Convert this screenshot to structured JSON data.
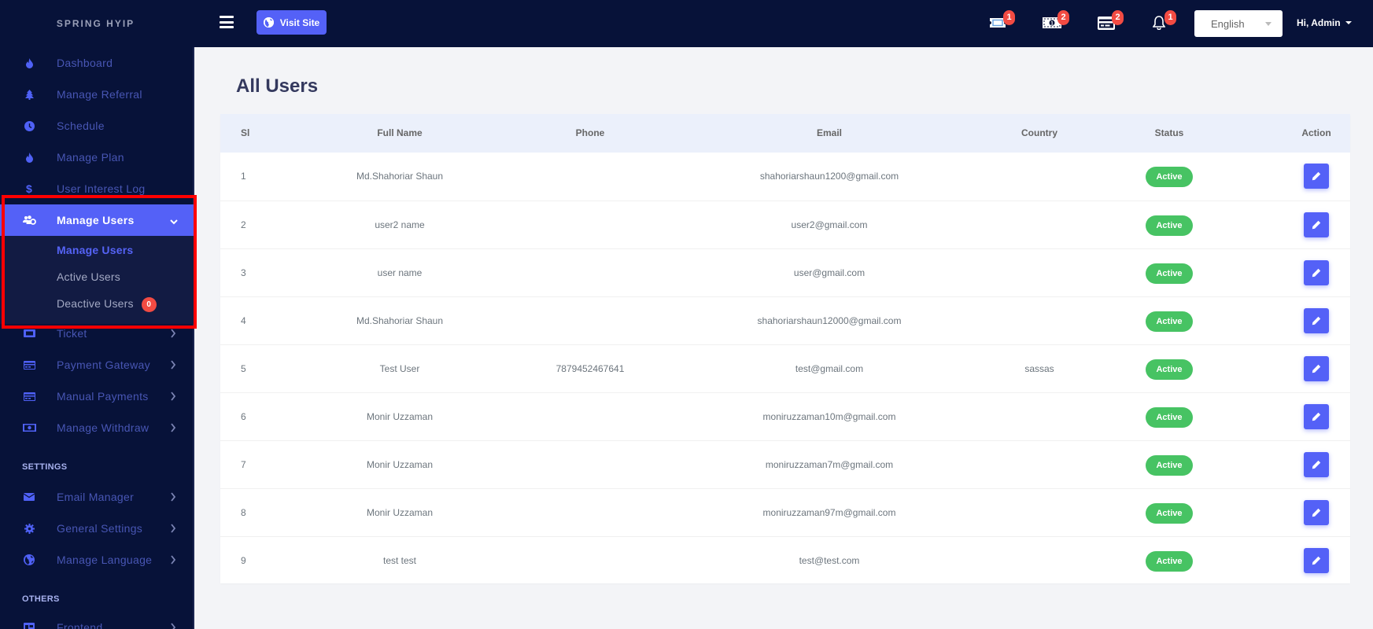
{
  "brand": "SPRING HYIP",
  "sidebar": {
    "items": [
      {
        "label": "Dashboard",
        "icon": "fire-icon"
      },
      {
        "label": "Manage Referral",
        "icon": "tree-icon"
      },
      {
        "label": "Schedule",
        "icon": "clock-icon"
      },
      {
        "label": "Manage Plan",
        "icon": "fire-icon"
      },
      {
        "label": "User Interest Log",
        "icon": "dollar-icon"
      },
      {
        "label": "Manage Users",
        "icon": "users-cog-icon",
        "active": true,
        "expanded": true
      },
      {
        "label": "Ticket",
        "icon": "ticket-icon"
      },
      {
        "label": "Payment Gateway",
        "icon": "credit-card-icon"
      },
      {
        "label": "Manual Payments",
        "icon": "credit-card-icon"
      },
      {
        "label": "Manage Withdraw",
        "icon": "money-bill-icon"
      }
    ],
    "submenu": [
      {
        "label": "Manage Users",
        "current": true
      },
      {
        "label": "Active Users"
      },
      {
        "label": "Deactive Users",
        "badge": "0"
      }
    ],
    "settings_title": "SETTINGS",
    "settings_items": [
      {
        "label": "Email Manager",
        "icon": "envelope-icon"
      },
      {
        "label": "General Settings",
        "icon": "gear-icon"
      },
      {
        "label": "Manage Language",
        "icon": "globe-icon"
      }
    ],
    "others_title": "OTHERS",
    "others_items": [
      {
        "label": "Frontend",
        "icon": "layout-icon"
      }
    ]
  },
  "topbar": {
    "visit_site_label": "Visit Site",
    "notifications": [
      {
        "icon": "ticket-icon",
        "count": "1"
      },
      {
        "icon": "money-bill-icon",
        "count": "2"
      },
      {
        "icon": "credit-card-icon",
        "count": "2"
      },
      {
        "icon": "bell-icon",
        "count": "1"
      }
    ],
    "language": "English",
    "user_greeting": "Hi, Admin"
  },
  "page": {
    "title": "All Users"
  },
  "table": {
    "columns": [
      "Sl",
      "Full Name",
      "Phone",
      "Email",
      "Country",
      "Status",
      "Action"
    ],
    "rows": [
      {
        "sl": "1",
        "name": "Md.Shahoriar Shaun",
        "phone": "",
        "email": "shahoriarshaun1200@gmail.com",
        "country": "",
        "status": "Active"
      },
      {
        "sl": "2",
        "name": "user2 name",
        "phone": "",
        "email": "user2@gmail.com",
        "country": "",
        "status": "Active"
      },
      {
        "sl": "3",
        "name": "user name",
        "phone": "",
        "email": "user@gmail.com",
        "country": "",
        "status": "Active"
      },
      {
        "sl": "4",
        "name": "Md.Shahoriar Shaun",
        "phone": "",
        "email": "shahoriarshaun12000@gmail.com",
        "country": "",
        "status": "Active"
      },
      {
        "sl": "5",
        "name": "Test User",
        "phone": "7879452467641",
        "email": "test@gmail.com",
        "country": "sassas",
        "status": "Active"
      },
      {
        "sl": "6",
        "name": "Monir Uzzaman",
        "phone": "",
        "email": "moniruzzaman10m@gmail.com",
        "country": "",
        "status": "Active"
      },
      {
        "sl": "7",
        "name": "Monir Uzzaman",
        "phone": "",
        "email": "moniruzzaman7m@gmail.com",
        "country": "",
        "status": "Active"
      },
      {
        "sl": "8",
        "name": "Monir Uzzaman",
        "phone": "",
        "email": "moniruzzaman97m@gmail.com",
        "country": "",
        "status": "Active"
      },
      {
        "sl": "9",
        "name": "test test",
        "phone": "",
        "email": "test@test.com",
        "country": "",
        "status": "Active"
      }
    ]
  },
  "colors": {
    "sidebar_bg": "#071239",
    "accent": "#5461f7",
    "active_status": "#47c363",
    "badge": "#f24b43",
    "highlight_box": "#ff0000"
  }
}
